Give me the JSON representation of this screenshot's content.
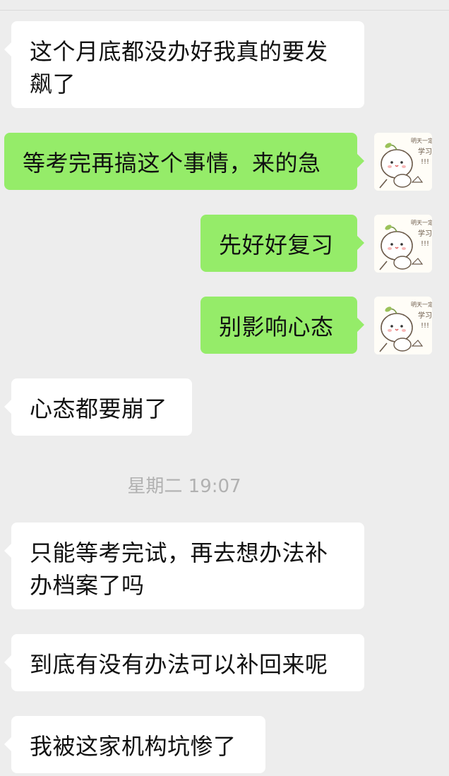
{
  "chat": {
    "messages": [
      {
        "side": "left",
        "text": "这个月底都没办好我真的要发飙了"
      },
      {
        "side": "right",
        "text": "等考完再搞这个事情，来的急"
      },
      {
        "side": "right",
        "text": "先好好复习"
      },
      {
        "side": "right",
        "text": "别影响心态"
      },
      {
        "side": "left",
        "text": "心态都要崩了"
      },
      {
        "side": "left",
        "text": "只能等考完试，再去想办法补办档案了吗"
      },
      {
        "side": "left",
        "text": "到底有没有办法可以补回来呢"
      },
      {
        "side": "left",
        "text": "我被这家机构坑惨了"
      }
    ],
    "timestamp": "星期二 19:07",
    "avatar": {
      "icon": "cartoon-avatar-icon",
      "caption": "明天一定努力学习!!!"
    }
  },
  "colors": {
    "background": "#ededed",
    "received_bubble": "#ffffff",
    "sent_bubble": "#95ec69",
    "timestamp_text": "#b1b1b1"
  }
}
